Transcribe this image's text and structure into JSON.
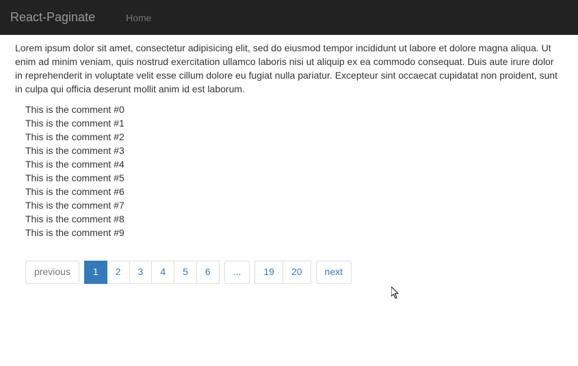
{
  "navbar": {
    "brand": "React-Paginate",
    "home_label": "Home"
  },
  "intro": "Lorem ipsum dolor sit amet, consectetur adipisicing elit, sed do eiusmod tempor incididunt ut labore et dolore magna aliqua. Ut enim ad minim veniam, quis nostrud exercitation ullamco laboris nisi ut aliquip ex ea commodo consequat. Duis aute irure dolor in reprehenderit in voluptate velit esse cillum dolore eu fugiat nulla pariatur. Excepteur sint occaecat cupidatat non proident, sunt in culpa qui officia deserunt mollit anim id est laborum.",
  "comments": [
    "This is the comment #0",
    "This is the comment #1",
    "This is the comment #2",
    "This is the comment #3",
    "This is the comment #4",
    "This is the comment #5",
    "This is the comment #6",
    "This is the comment #7",
    "This is the comment #8",
    "This is the comment #9"
  ],
  "pagination": {
    "previous": "previous",
    "next": "next",
    "pages": [
      "1",
      "2",
      "3",
      "4",
      "5",
      "6"
    ],
    "break": "...",
    "end_pages": [
      "19",
      "20"
    ],
    "active_page": "1"
  }
}
